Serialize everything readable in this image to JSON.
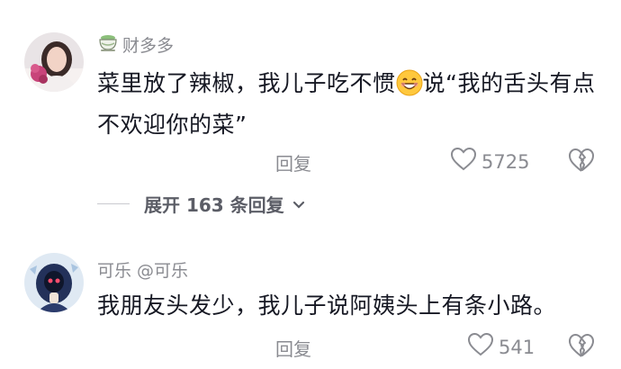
{
  "comments": [
    {
      "username": "财多多",
      "badge_icon": "tea-cup-icon",
      "text_before_emoji": "菜里放了辣椒，我儿子吃不惯",
      "emoji": "grinning-face-emoji",
      "text_after_emoji": "说“我的舌头有点不欢迎你的菜”",
      "reply_label": "回复",
      "like_count": "5725"
    },
    {
      "username": "可乐 @可乐",
      "text": "我朋友头发少，我儿子说阿姨头上有条小路。",
      "reply_label": "回复",
      "like_count": "541"
    }
  ],
  "expand_replies": "展开 163 条回复",
  "colors": {
    "text_primary": "#161823",
    "text_secondary": "#8a8b91",
    "accent_bg": "#ffffff"
  }
}
